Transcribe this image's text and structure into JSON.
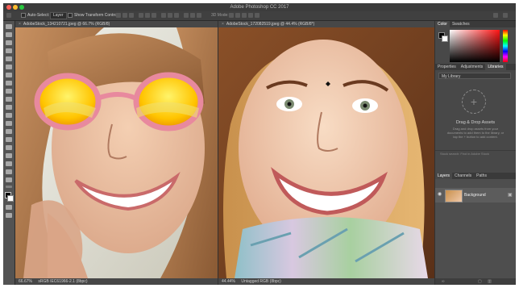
{
  "window": {
    "title": "Adobe Photoshop CC 2017"
  },
  "options_bar": {
    "auto_select_label": "Auto-Select:",
    "auto_select_target": "Layer",
    "show_transform_controls": "Show Transform Controls",
    "mode_label": "3D Mode:"
  },
  "documents": [
    {
      "tab_title": "AdobeStock_134210721.jpeg @ 66.7% (RGB/8)",
      "zoom": "66.67%",
      "status_info": "sRGB IEC61966-2.1 (8bpc)"
    },
    {
      "tab_title": "AdobeStock_172082519.jpeg @ 44.4% (RGB/8*)",
      "zoom": "44.44%",
      "status_info": "Untagged RGB (8bpc)"
    }
  ],
  "panels": {
    "color_tabs": [
      "Color",
      "Swatches"
    ],
    "lib_tabs": [
      "Properties",
      "Adjustments",
      "Libraries"
    ],
    "library_selected": "My Library",
    "drop_heading": "Drag & Drop Assets",
    "drop_desc": "Drag and drop assets from your documents to add them to the library, or tap the + button to add content.",
    "lib_footer": "Stock search: Find in Adobe Stock",
    "layers_tabs": [
      "Layers",
      "Channels",
      "Paths"
    ],
    "layer_name": "Background"
  },
  "colors": {
    "foreground": "#000000",
    "background": "#ffffff",
    "accent": "#ff1414"
  }
}
